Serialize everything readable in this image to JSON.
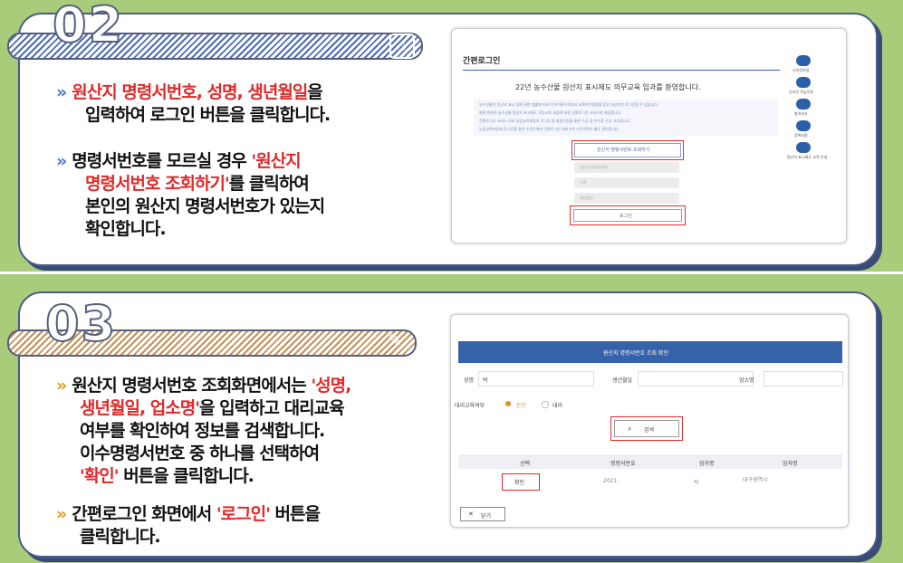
{
  "step2": {
    "number": "02",
    "bullet1": {
      "red": "원산지 명령서번호, 성명, 생년월일",
      "rest": "을",
      "line2": "입력하여 로그인 버튼을 클릭합니다."
    },
    "bullet2": {
      "line1a": "명령서번호를 모르실 경우 ",
      "red1": "'원산지",
      "red2": "명령서번호 조회하기'",
      "line2b": "를 클릭하여",
      "line3": "본인의 원산지 명령서번호가 있는지",
      "line4": "확인합니다."
    },
    "screen": {
      "title": "간편로그인",
      "welcome": "22년 농수산물 원산지 표시제도 의무교육 입과를 환영합니다.",
      "notice": [
        "농수산물의 원산지 표시 등에 관한 법률에 따라 단속기관으로부터 교육이수명령을 받은 대상자만 로그인할 수 있습니다.",
        "현재 화면은 농수산물 원산지 표시제도 의무교육 과정에 대한 간편로그인 서비스만 제공합니다.",
        "간편로그인 서비스 이외 농업교육포털의 로그인 및 회원가입을 통한 수강 및 이수증 수강 가능합니다.",
        "농업교육포털에 로그인을 통한 수강이력과 간편로그인 서비스의 수강이력은 별도 관리합니다."
      ],
      "lookup_button": "원산지 명령서번호 조회하기",
      "placeholder_number": "원산지 명령서번호",
      "placeholder_name": "성명",
      "placeholder_birth": "생년월일",
      "login_button": "로그인",
      "side_icons": [
        "나의강의실",
        "온라인 학습지원",
        "충의의사",
        "정책지원",
        "원산지 표시제도 교육 안내"
      ]
    }
  },
  "step3": {
    "number": "03",
    "bullet1": {
      "a": "원산지 명령서번호 조회화면에서는 ",
      "redA": "'성명,",
      "redB": "생년월일, 업소명'",
      "b": "을 입력하고 대리교육",
      "line3": "여부를 확인하여 정보를 검색합니다.",
      "line4": "이수명령서번호 중 하나를 선택하여",
      "redC": "'확인'",
      "line5": " 버튼을 클릭합니다."
    },
    "bullet2": {
      "a": "간편로그인 화면에서 ",
      "red": "'로그인'",
      "b": " 버튼을",
      "line2": "클릭합니다."
    },
    "screen": {
      "header": "원산지 명령서번호 조회 확인",
      "label_name": "성명",
      "value_name": "박",
      "label_birth": "생년월일",
      "label_business": "업소명",
      "label_proxy": "대리교육여부",
      "opt_self": "본인",
      "opt_proxy": "대리",
      "search_button": "검색",
      "columns": [
        "선택",
        "명령서번호",
        "업자명",
        "업자명"
      ],
      "row": {
        "select": "확인",
        "number": "2021 -",
        "owner": "박",
        "place": "대구광역시"
      },
      "close_button": "닫기"
    }
  },
  "colors": {
    "background": "#a9cc7b",
    "accent_red": "#e12a2a",
    "header_blue": "#3562a8"
  }
}
